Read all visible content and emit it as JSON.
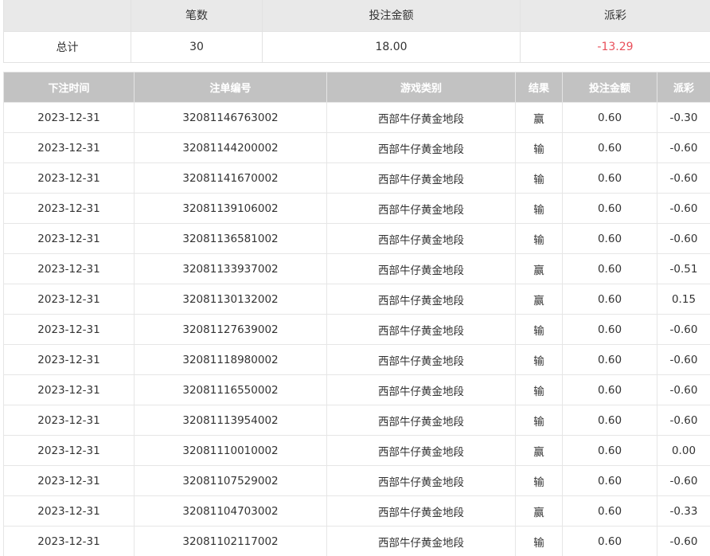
{
  "summary": {
    "headers": [
      "",
      "笔数",
      "投注金额",
      "派彩"
    ],
    "row_label": "总计",
    "count": "30",
    "bet_total": "18.00",
    "payout_total": "-13.29"
  },
  "detail": {
    "headers": [
      "下注时间",
      "注单编号",
      "游戏类别",
      "结果",
      "投注金额",
      "派彩"
    ],
    "rows": [
      {
        "time": "2023-12-31",
        "id": "32081146763002",
        "game": "西部牛仔黄金地段",
        "result": "赢",
        "bet": "0.60",
        "payout": "-0.30",
        "neg": true
      },
      {
        "time": "2023-12-31",
        "id": "32081144200002",
        "game": "西部牛仔黄金地段",
        "result": "输",
        "bet": "0.60",
        "payout": "-0.60",
        "neg": true
      },
      {
        "time": "2023-12-31",
        "id": "32081141670002",
        "game": "西部牛仔黄金地段",
        "result": "输",
        "bet": "0.60",
        "payout": "-0.60",
        "neg": true
      },
      {
        "time": "2023-12-31",
        "id": "32081139106002",
        "game": "西部牛仔黄金地段",
        "result": "输",
        "bet": "0.60",
        "payout": "-0.60",
        "neg": true
      },
      {
        "time": "2023-12-31",
        "id": "32081136581002",
        "game": "西部牛仔黄金地段",
        "result": "输",
        "bet": "0.60",
        "payout": "-0.60",
        "neg": true
      },
      {
        "time": "2023-12-31",
        "id": "32081133937002",
        "game": "西部牛仔黄金地段",
        "result": "赢",
        "bet": "0.60",
        "payout": "-0.51",
        "neg": true
      },
      {
        "time": "2023-12-31",
        "id": "32081130132002",
        "game": "西部牛仔黄金地段",
        "result": "赢",
        "bet": "0.60",
        "payout": "0.15",
        "neg": false
      },
      {
        "time": "2023-12-31",
        "id": "32081127639002",
        "game": "西部牛仔黄金地段",
        "result": "输",
        "bet": "0.60",
        "payout": "-0.60",
        "neg": true
      },
      {
        "time": "2023-12-31",
        "id": "32081118980002",
        "game": "西部牛仔黄金地段",
        "result": "输",
        "bet": "0.60",
        "payout": "-0.60",
        "neg": true
      },
      {
        "time": "2023-12-31",
        "id": "32081116550002",
        "game": "西部牛仔黄金地段",
        "result": "输",
        "bet": "0.60",
        "payout": "-0.60",
        "neg": true
      },
      {
        "time": "2023-12-31",
        "id": "32081113954002",
        "game": "西部牛仔黄金地段",
        "result": "输",
        "bet": "0.60",
        "payout": "-0.60",
        "neg": true
      },
      {
        "time": "2023-12-31",
        "id": "32081110010002",
        "game": "西部牛仔黄金地段",
        "result": "赢",
        "bet": "0.60",
        "payout": "0.00",
        "neg": false
      },
      {
        "time": "2023-12-31",
        "id": "32081107529002",
        "game": "西部牛仔黄金地段",
        "result": "输",
        "bet": "0.60",
        "payout": "-0.60",
        "neg": true
      },
      {
        "time": "2023-12-31",
        "id": "32081104703002",
        "game": "西部牛仔黄金地段",
        "result": "赢",
        "bet": "0.60",
        "payout": "-0.33",
        "neg": true
      },
      {
        "time": "2023-12-31",
        "id": "32081102117002",
        "game": "西部牛仔黄金地段",
        "result": "输",
        "bet": "0.60",
        "payout": "-0.60",
        "neg": true
      }
    ]
  },
  "colors": {
    "negative": "#e8505b",
    "header_bg": "#c2c2c2",
    "summary_header_bg": "#e9e9e9"
  }
}
